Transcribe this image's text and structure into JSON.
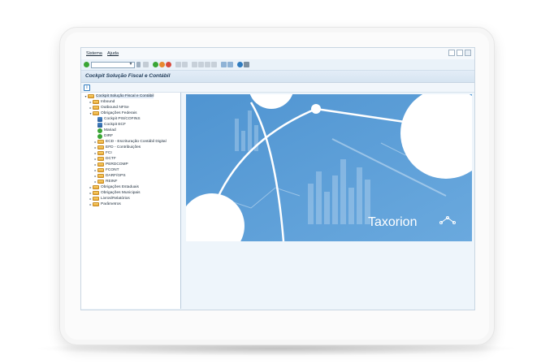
{
  "menubar": {
    "items": [
      {
        "label": "Sistema"
      },
      {
        "label": "Ajuda"
      }
    ]
  },
  "toolbar": {
    "command_value": ""
  },
  "window": {
    "title": "Cockpit Solução Fiscal e Contábil"
  },
  "tree": {
    "root": "Cockpit Solução Fiscal e Contábil",
    "items": [
      {
        "label": "Inbound"
      },
      {
        "label": "Outbound NFSe"
      },
      {
        "label": "Obrigações Federais"
      },
      {
        "label": "Cockpit PIS/COFINS"
      },
      {
        "label": "Cockpit ECF"
      },
      {
        "label": "Mariad"
      },
      {
        "label": "DIRF"
      },
      {
        "label": "ECD - Escrituração Contábil Digital"
      },
      {
        "label": "EFD - Contribuições"
      },
      {
        "label": "FCI"
      },
      {
        "label": "DCTF"
      },
      {
        "label": "PERDCOMP"
      },
      {
        "label": "FCONT"
      },
      {
        "label": "DARF/GPS"
      },
      {
        "label": "REINF"
      },
      {
        "label": "Obrigações Estaduais"
      },
      {
        "label": "Obrigações Municipais"
      },
      {
        "label": "Livros/Relatórios"
      },
      {
        "label": "Parâmetros"
      }
    ]
  },
  "banner": {
    "brand": "Taxorion"
  },
  "colors": {
    "banner_blue": "#5b9fd8",
    "accent_green": "#3aa535"
  }
}
